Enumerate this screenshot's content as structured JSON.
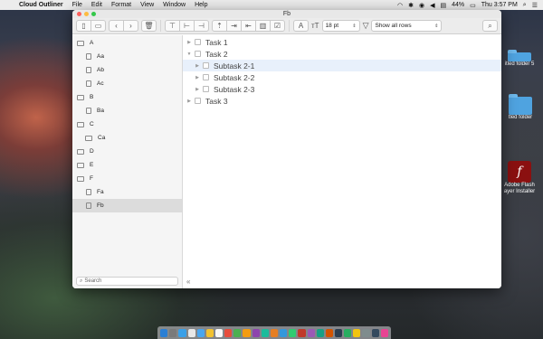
{
  "menubar": {
    "app_name": "Cloud Outliner",
    "menus": [
      "File",
      "Edit",
      "Format",
      "View",
      "Window",
      "Help"
    ],
    "battery": "44%",
    "clock": "Thu 3:57 PM"
  },
  "desktop": {
    "icon_folder_1": "itled folder 5",
    "icon_folder_2": "tled folder",
    "icon_flash_1": "Adobe Flash",
    "icon_flash_2": "ayer Installer"
  },
  "window": {
    "title": "Fb",
    "toolbar": {
      "font_size": "18 pt",
      "filter": "Show all rows"
    }
  },
  "sidebar": {
    "items": [
      {
        "label": "A",
        "kind": "folder",
        "level": 0
      },
      {
        "label": "Aa",
        "kind": "doc",
        "level": 1
      },
      {
        "label": "Ab",
        "kind": "doc",
        "level": 1
      },
      {
        "label": "Ac",
        "kind": "doc",
        "level": 1
      },
      {
        "label": "B",
        "kind": "folder",
        "level": 0
      },
      {
        "label": "Ba",
        "kind": "doc",
        "level": 1
      },
      {
        "label": "C",
        "kind": "folder",
        "level": 0
      },
      {
        "label": "Ca",
        "kind": "folder",
        "level": 1
      },
      {
        "label": "D",
        "kind": "folder",
        "level": 0
      },
      {
        "label": "E",
        "kind": "folder",
        "level": 0
      },
      {
        "label": "F",
        "kind": "folder",
        "level": 0
      },
      {
        "label": "Fa",
        "kind": "doc",
        "level": 1
      },
      {
        "label": "Fb",
        "kind": "doc",
        "level": 1,
        "selected": true
      }
    ],
    "search_placeholder": "Search"
  },
  "outline": {
    "rows": [
      {
        "label": "Task 1",
        "level": 0,
        "expanded": false
      },
      {
        "label": "Task 2",
        "level": 0,
        "expanded": true
      },
      {
        "label": "Subtask 2-1",
        "level": 1,
        "expanded": false,
        "selected": true
      },
      {
        "label": "Subtask 2-2",
        "level": 1,
        "expanded": false
      },
      {
        "label": "Subtask 2-3",
        "level": 1,
        "expanded": false
      },
      {
        "label": "Task 3",
        "level": 0,
        "expanded": false
      }
    ]
  },
  "colors": {
    "close": "#fc605c",
    "minimize": "#fdbc40",
    "zoom": "#34c84a",
    "selection": "#e8f0fb"
  }
}
